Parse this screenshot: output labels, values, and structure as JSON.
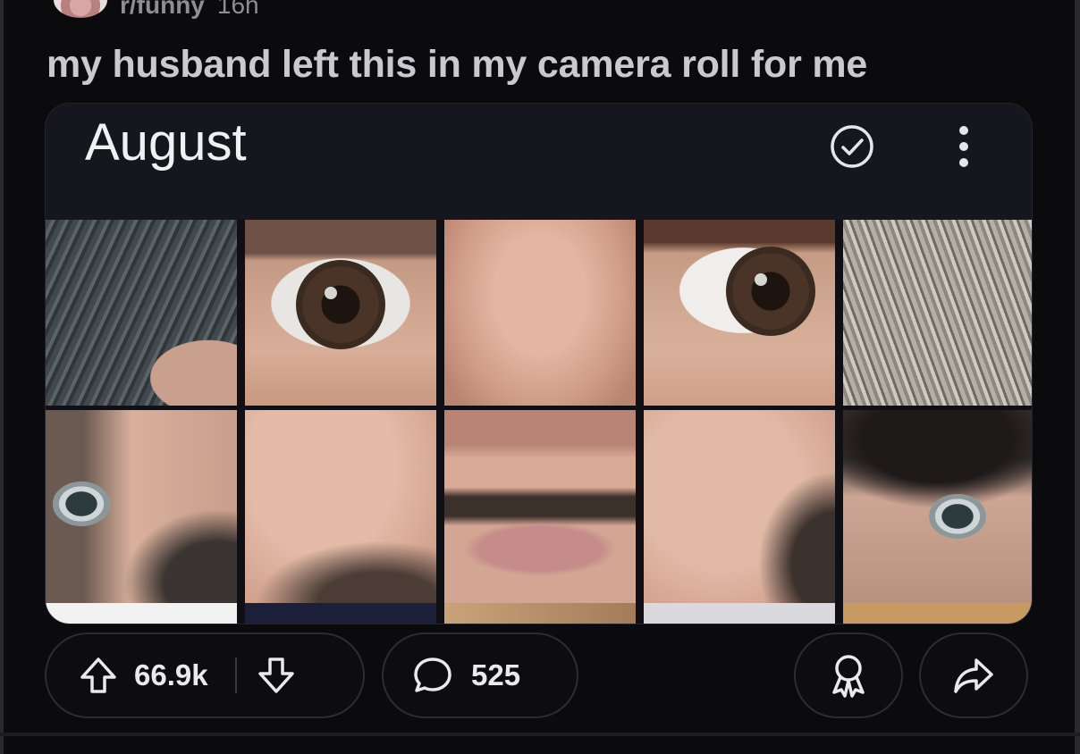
{
  "post": {
    "username": "r/funny",
    "time_ago": "16h",
    "title": "my husband left this in my camera roll for me"
  },
  "gallery": {
    "album_title": "August",
    "select_icon": "check-circle-icon",
    "menu_icon": "kebab-menu-icon"
  },
  "actions": {
    "upvotes": "66.9k",
    "comments": "525",
    "upvote_icon": "upvote-arrow-icon",
    "downvote_icon": "downvote-arrow-icon",
    "comment_icon": "speech-bubble-icon",
    "award_icon": "award-ribbon-icon",
    "share_icon": "share-arrow-icon"
  },
  "colors": {
    "background": "#0b0b0d",
    "card": "#16161f",
    "text_primary": "#e9e9ee",
    "title_text": "#c9c9cf"
  }
}
